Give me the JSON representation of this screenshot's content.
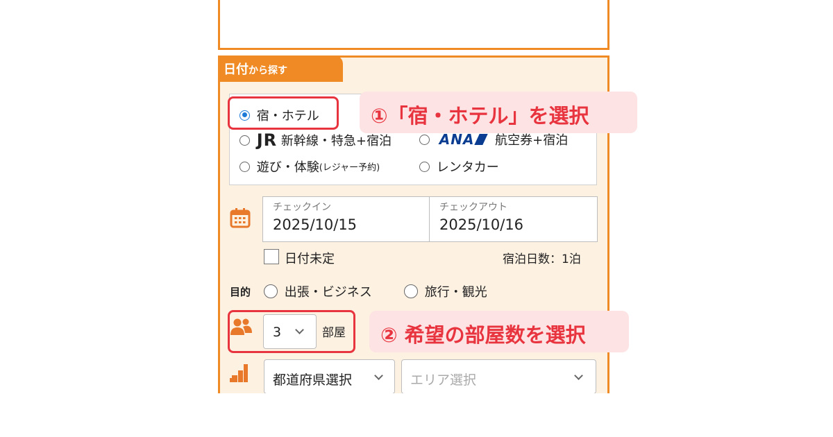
{
  "search_panel": {
    "tab_title_main": "日付",
    "tab_title_sub": "から探す"
  },
  "type_options": [
    {
      "label": "宿・ホテル",
      "selected": true
    },
    {
      "label_logo": "JR",
      "label": "新幹線・特急+宿泊",
      "selected": false
    },
    {
      "label_logo": "ANA",
      "label": "航空券+宿泊",
      "selected": false
    },
    {
      "label": "遊び・体験",
      "label_sub": "(レジャー予約)",
      "selected": false
    },
    {
      "label": "レンタカー",
      "selected": false
    }
  ],
  "dates": {
    "checkin_label": "チェックイン",
    "checkin_value": "2025/10/15",
    "checkout_label": "チェックアウト",
    "checkout_value": "2025/10/16",
    "undecided_label": "日付未定",
    "nights_label": "宿泊日数：1泊"
  },
  "purpose": {
    "label": "目的",
    "options": [
      "出張・ビジネス",
      "旅行・観光"
    ]
  },
  "rooms": {
    "value": "3",
    "unit": "部屋"
  },
  "area": {
    "prefecture_select": "都道府県選択",
    "area_select": "エリア選択"
  },
  "callouts": {
    "step1": "①「宿・ホテル」を選択",
    "step2": "② 希望の部屋数を選択"
  },
  "colors": {
    "accent_orange": "#f08a24",
    "highlight_red": "#e8343f",
    "callout_bg": "#fde3e3",
    "panel_bg": "#fdf1e2",
    "radio_blue": "#1c7bd8"
  },
  "icons": [
    "calendar-icon",
    "people-icon",
    "map-area-icon",
    "chevron-down-icon"
  ]
}
